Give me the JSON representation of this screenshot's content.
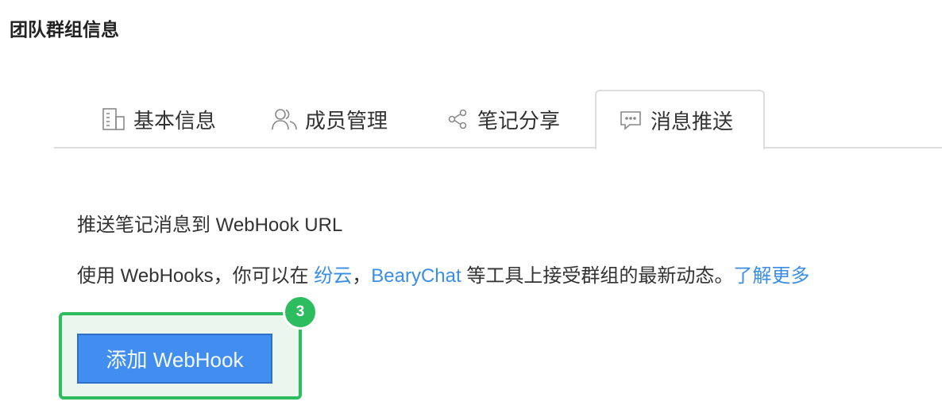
{
  "title": "团队群组信息",
  "tabs": [
    {
      "label": "基本信息",
      "icon": "building-icon"
    },
    {
      "label": "成员管理",
      "icon": "users-icon"
    },
    {
      "label": "笔记分享",
      "icon": "share-icon"
    },
    {
      "label": "消息推送",
      "icon": "chat-icon",
      "active": true
    }
  ],
  "content": {
    "heading": "推送笔记消息到 WebHook URL",
    "desc_prefix": "使用 WebHooks，你可以在 ",
    "link_fenyun": "纷云",
    "comma": "，",
    "link_bearychat": "BearyChat",
    "desc_suffix": " 等工具上接受群组的最新动态。",
    "learn_more": "了解更多",
    "add_button": "添加 WebHook",
    "badge": "3"
  },
  "colors": {
    "accent": "#428ef0",
    "highlight": "#2dbd5e",
    "link": "#3a8ee6"
  }
}
